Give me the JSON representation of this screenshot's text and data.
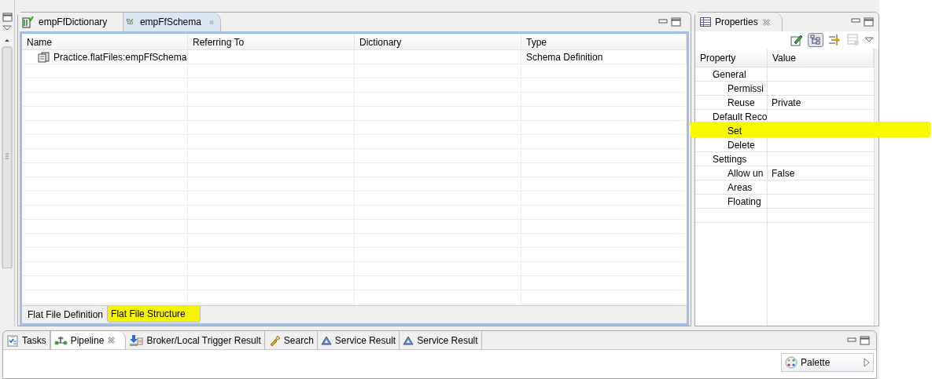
{
  "editor": {
    "tabs": [
      {
        "label": "empFfDictionary",
        "selected": false
      },
      {
        "label": "empFfSchema",
        "selected": true
      }
    ],
    "table": {
      "columns": [
        "Name",
        "Referring To",
        "Dictionary",
        "Type"
      ],
      "rows": [
        [
          "Practice.flatFiles:empFfSchema",
          "",
          "",
          "Schema Definition"
        ]
      ]
    },
    "bottom_tabs": [
      {
        "label": "Flat File Definition",
        "selected": false,
        "highlighted": false
      },
      {
        "label": "Flat File Structure",
        "selected": true,
        "highlighted": true
      }
    ]
  },
  "properties": {
    "title": "Properties",
    "columns": [
      "Property",
      "Value"
    ],
    "items": [
      {
        "name": "General",
        "highlighted": false,
        "children": [
          {
            "name": "Permissi",
            "highlighted": false
          },
          {
            "name": "Reuse",
            "value": "Private",
            "highlighted": false
          }
        ]
      },
      {
        "name": "Default Reco",
        "highlighted": false,
        "children": [
          {
            "name": "Set",
            "highlighted": true
          },
          {
            "name": "Delete",
            "highlighted": false
          }
        ]
      },
      {
        "name": "Settings",
        "highlighted": false,
        "children": [
          {
            "name": "Allow un",
            "value": "False",
            "highlighted": false
          },
          {
            "name": "Areas",
            "highlighted": false
          },
          {
            "name": "Floating",
            "highlighted": false
          }
        ]
      }
    ]
  },
  "bottom_panel": {
    "tabs": [
      {
        "label": "Tasks",
        "kind": "tasks",
        "selected": false
      },
      {
        "label": "Pipeline",
        "kind": "pipeline",
        "selected": true
      },
      {
        "label": "Broker/Local Trigger Result",
        "kind": "broker",
        "selected": false
      },
      {
        "label": "Search",
        "kind": "search",
        "selected": false
      },
      {
        "label": "Service Result",
        "kind": "result",
        "selected": false
      },
      {
        "label": "Service Result",
        "kind": "result",
        "selected": false
      }
    ],
    "palette": {
      "title": "Palette"
    }
  }
}
